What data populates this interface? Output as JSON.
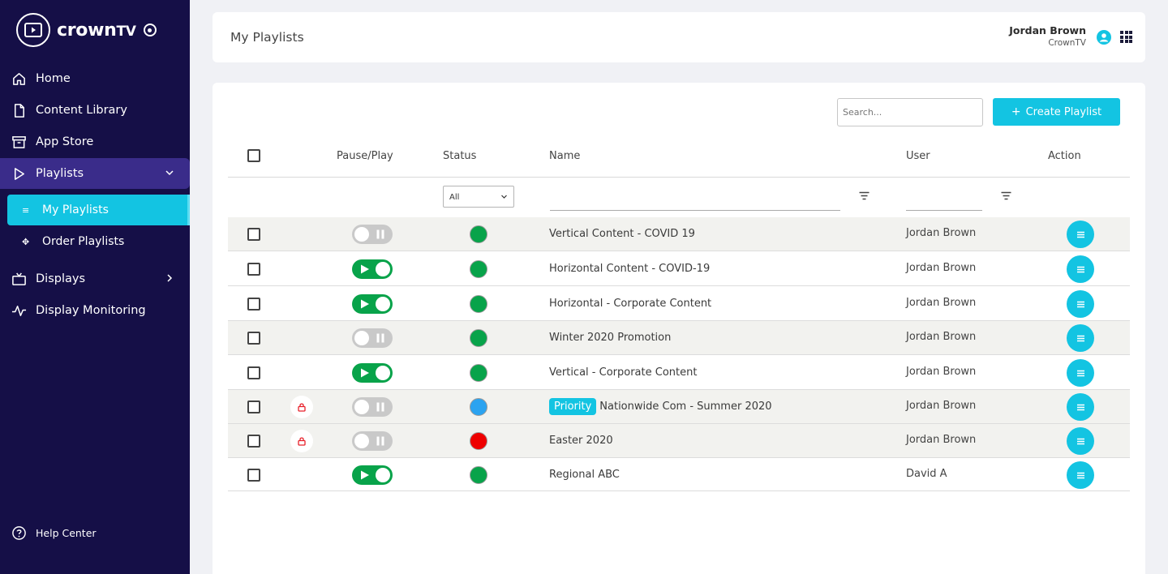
{
  "app": {
    "logo_text": "crown",
    "logo_tv": "TV"
  },
  "nav": {
    "home": "Home",
    "content_library": "Content Library",
    "app_store": "App Store",
    "playlists": "Playlists",
    "my_playlists": "My Playlists",
    "order_playlists": "Order Playlists",
    "displays": "Displays",
    "display_monitoring": "Display Monitoring",
    "help_center": "Help Center"
  },
  "header": {
    "title": "My Playlists",
    "user_name": "Jordan Brown",
    "user_org": "CrownTV"
  },
  "toolbar": {
    "search_placeholder": "Search...",
    "create_label": "Create Playlist"
  },
  "table": {
    "columns": {
      "pause_play": "Pause/Play",
      "status": "Status",
      "name": "Name",
      "user": "User",
      "action": "Action"
    },
    "status_filter": "All",
    "rows": [
      {
        "name": "Vertical Content - COVID 19",
        "user": "Jordan Brown",
        "playing": false,
        "status_color": "#08a34a",
        "locked": false,
        "priority": ""
      },
      {
        "name": "Horizontal Content - COVID-19",
        "user": "Jordan Brown",
        "playing": true,
        "status_color": "#08a34a",
        "locked": false,
        "priority": ""
      },
      {
        "name": "Horizontal - Corporate Content",
        "user": "Jordan Brown",
        "playing": true,
        "status_color": "#08a34a",
        "locked": false,
        "priority": ""
      },
      {
        "name": "Winter 2020 Promotion",
        "user": "Jordan Brown",
        "playing": false,
        "status_color": "#08a34a",
        "locked": false,
        "priority": ""
      },
      {
        "name": "Vertical - Corporate Content",
        "user": "Jordan Brown",
        "playing": true,
        "status_color": "#08a34a",
        "locked": false,
        "priority": ""
      },
      {
        "name": "Nationwide Com - Summer 2020",
        "user": "Jordan Brown",
        "playing": false,
        "status_color": "#2ba3f0",
        "locked": true,
        "priority": "Priority"
      },
      {
        "name": "Easter 2020",
        "user": "Jordan Brown",
        "playing": false,
        "status_color": "#ee0000",
        "locked": true,
        "priority": ""
      },
      {
        "name": "Regional ABC",
        "user": "David A",
        "playing": true,
        "status_color": "#08a34a",
        "locked": false,
        "priority": ""
      }
    ]
  }
}
